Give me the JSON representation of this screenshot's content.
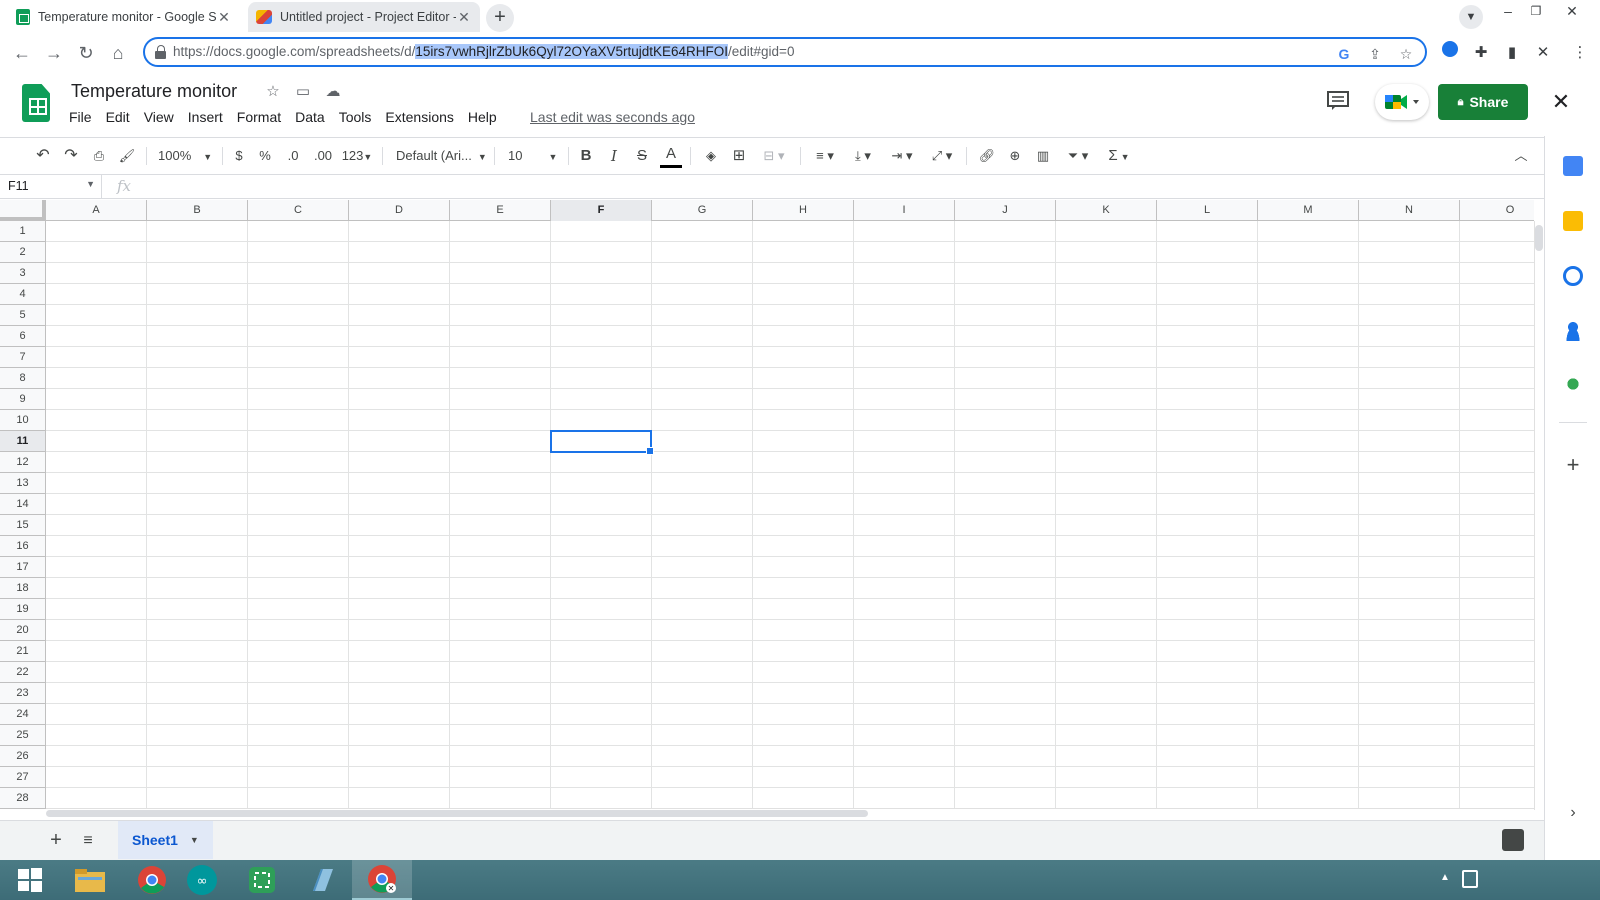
{
  "browser": {
    "tabs": [
      {
        "title": "Temperature monitor - Google S",
        "active": true
      },
      {
        "title": "Untitled project - Project Editor -",
        "active": false
      }
    ],
    "url": {
      "prefix": "https://docs.google.com/spreadsheets/d/",
      "selected": "15irs7vwhRjlrZbUk6Qyl72OYaXV5rtujdtKE64RHFOI",
      "suffix": "/edit#gid=0"
    }
  },
  "doc": {
    "title": "Temperature monitor",
    "menu": [
      "File",
      "Edit",
      "View",
      "Insert",
      "Format",
      "Data",
      "Tools",
      "Extensions",
      "Help"
    ],
    "last_edit": "Last edit was seconds ago",
    "share_label": "Share"
  },
  "toolbar": {
    "zoom": "100%",
    "currency": "$",
    "percent": "%",
    "dec_decrease": ".0",
    "dec_increase": ".00",
    "more_formats": "123",
    "font": "Default (Ari...",
    "font_size": "10",
    "bold": "B",
    "italic": "I",
    "strike": "S",
    "text_color": "A",
    "sum": "Σ"
  },
  "formula_bar": {
    "name_box": "F11",
    "fx": "fx",
    "value": ""
  },
  "grid": {
    "columns": [
      "A",
      "B",
      "C",
      "D",
      "E",
      "F",
      "G",
      "H",
      "I",
      "J",
      "K",
      "L",
      "M",
      "N",
      "O"
    ],
    "selected_column": "F",
    "rows": [
      "1",
      "2",
      "3",
      "4",
      "5",
      "6",
      "7",
      "8",
      "9",
      "10",
      "11",
      "12",
      "13",
      "14",
      "15",
      "16",
      "17",
      "18",
      "19",
      "20",
      "21",
      "22",
      "23",
      "24",
      "25",
      "26",
      "27",
      "28"
    ],
    "selected_row": "11"
  },
  "sheets": {
    "tabs": [
      "Sheet1"
    ],
    "active": "Sheet1"
  },
  "colors": {
    "accent": "#1a73e8",
    "share_green": "#188038",
    "sheets_green": "#0f9d58"
  }
}
